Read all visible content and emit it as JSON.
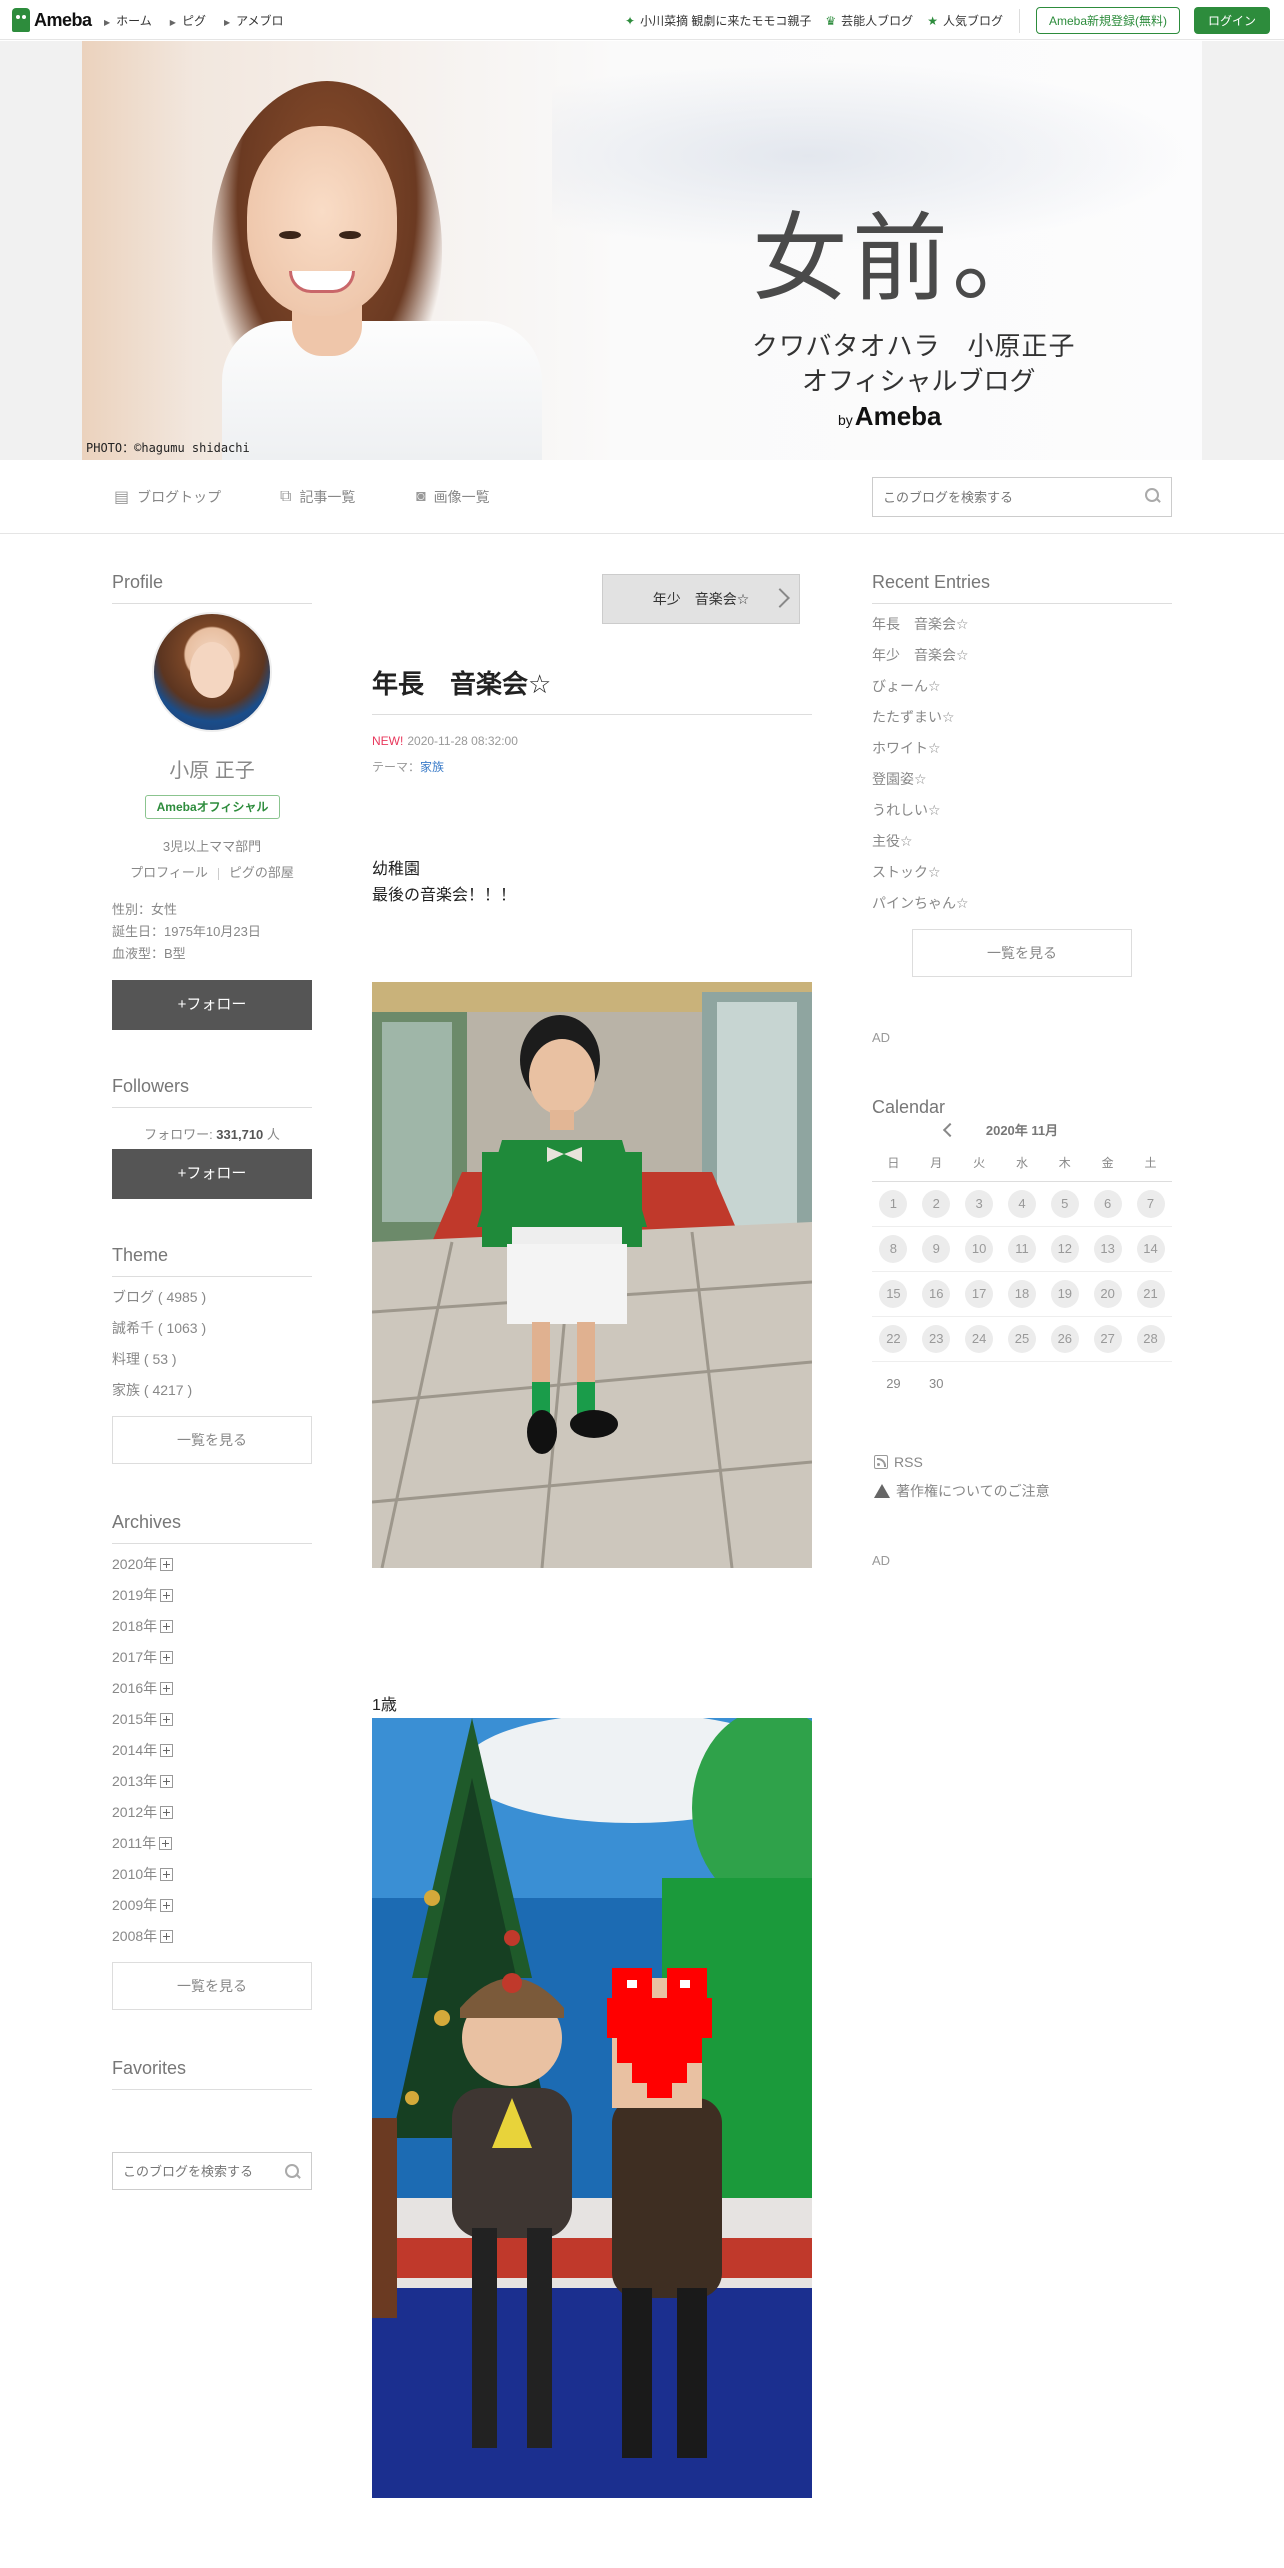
{
  "topbar": {
    "logo": "Ameba",
    "nav": [
      "ホーム",
      "ピグ",
      "アメブロ"
    ],
    "promos": [
      {
        "icon": "star-icon",
        "label": "小川菜摘 観劇に来たモモコ親子"
      },
      {
        "icon": "crown-icon",
        "label": "芸能人ブログ"
      },
      {
        "icon": "star-icon",
        "label": "人気ブログ"
      }
    ],
    "signup": "Ameba新規登録(無料)",
    "login": "ログイン"
  },
  "header": {
    "title": "女前。",
    "subtitle1": "クワバタオハラ　小原正子",
    "subtitle2": "オフィシャルブログ",
    "by_small": "by",
    "by": "Ameba",
    "credit": "PHOTO：©hagumu shidachi"
  },
  "subnav": {
    "items": [
      {
        "icon": "document-icon",
        "label": "ブログトップ"
      },
      {
        "icon": "copy-icon",
        "label": "記事一覧"
      },
      {
        "icon": "camera-icon",
        "label": "画像一覧"
      }
    ],
    "search_placeholder": "このブログを検索する"
  },
  "profile": {
    "heading": "Profile",
    "name": "小原 正子",
    "badge": "Amebaオフィシャル",
    "bio": "3児以上ママ部門",
    "link_profile": "プロフィール",
    "link_room": "ピグの部屋",
    "details": [
      "性別：女性",
      "誕生日：1975年10月23日",
      "血液型：B型"
    ],
    "follow": "+フォロー"
  },
  "followers": {
    "heading": "Followers",
    "label": "フォロワー: ",
    "count": "331,710",
    "unit": " 人",
    "follow": "+フォロー"
  },
  "theme": {
    "heading": "Theme",
    "items": [
      "ブログ ( 4985 )",
      "誠希千 ( 1063 )",
      "料理 ( 53 )",
      "家族 ( 4217 )"
    ],
    "more": "一覧を見る"
  },
  "archives": {
    "heading": "Archives",
    "items": [
      "2020年",
      "2019年",
      "2018年",
      "2017年",
      "2016年",
      "2015年",
      "2014年",
      "2013年",
      "2012年",
      "2011年",
      "2010年",
      "2009年",
      "2008年"
    ],
    "more": "一覧を見る"
  },
  "favorites": {
    "heading": "Favorites",
    "search_placeholder": "このブログを検索する"
  },
  "entry": {
    "prev_label": "年少　音楽会☆",
    "title": "年長　音楽会☆",
    "new_badge": "NEW!",
    "date": "2020-11-28 08:32:00",
    "theme_label": "テーマ：",
    "theme": "家族",
    "text1": "幼稚園",
    "text2": "最後の音楽会！！！",
    "caption2": "1歳"
  },
  "recent": {
    "heading": "Recent Entries",
    "items": [
      "年長　音楽会☆",
      "年少　音楽会☆",
      "びょーん☆",
      "たたずまい☆",
      "ホワイト☆",
      "登園姿☆",
      "うれしい☆",
      "主役☆",
      "ストック☆",
      "パインちゃん☆"
    ],
    "more": "一覧を見る"
  },
  "ad1": "AD",
  "calendar": {
    "heading": "Calendar",
    "month": "2020年 11月",
    "weekdays": [
      "日",
      "月",
      "火",
      "水",
      "木",
      "金",
      "土"
    ],
    "weeks": [
      [
        "1",
        "2",
        "3",
        "4",
        "5",
        "6",
        "7"
      ],
      [
        "8",
        "9",
        "10",
        "11",
        "12",
        "13",
        "14"
      ],
      [
        "15",
        "16",
        "17",
        "18",
        "19",
        "20",
        "21"
      ],
      [
        "22",
        "23",
        "24",
        "25",
        "26",
        "27",
        "28"
      ],
      [
        "29",
        "30",
        "",
        "",
        "",
        "",
        ""
      ]
    ]
  },
  "rss": "RSS",
  "copyright_notice": "著作権についてのご注意",
  "ad2": "AD"
}
